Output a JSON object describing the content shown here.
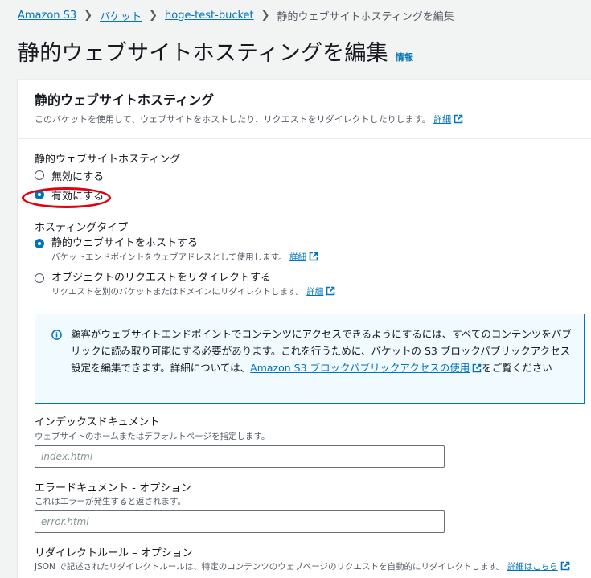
{
  "breadcrumb": {
    "items": [
      "Amazon S3",
      "バケット",
      "hoge-test-bucket"
    ],
    "current": "静的ウェブサイトホスティングを編集"
  },
  "page": {
    "title": "静的ウェブサイトホスティングを編集",
    "info_label": "情報"
  },
  "panel": {
    "title": "静的ウェブサイトホスティング",
    "description": "このバケットを使用して、ウェブサイトをホストしたり、リクエストをリダイレクトしたりします。",
    "description_link": "詳細"
  },
  "hosting": {
    "label": "静的ウェブサイトホスティング",
    "options": [
      "無効にする",
      "有効にする"
    ],
    "selected": "有効にする"
  },
  "hosting_type": {
    "label": "ホスティングタイプ",
    "options": [
      {
        "label": "静的ウェブサイトをホストする",
        "desc": "バケットエンドポイントをウェブアドレスとして使用します。",
        "link": "詳細"
      },
      {
        "label": "オブジェクトのリクエストをリダイレクトする",
        "desc": "リクエストを別のバケットまたはドメインにリダイレクトします。",
        "link": "詳細"
      }
    ],
    "selected": "静的ウェブサイトをホストする"
  },
  "alert": {
    "text_before": "顧客がウェブサイトエンドポイントでコンテンツにアクセスできるようにするには、すべてのコンテンツをパブリックに読み取り可能にする必要があります。これを行うために、バケットの S3 ブロックパブリックアクセス設定を編集できます。詳細については、",
    "link": "Amazon S3 ブロックパブリックアクセスの使用",
    "text_after": "をご覧ください"
  },
  "index_document": {
    "label": "インデックスドキュメント",
    "desc": "ウェブサイトのホームまたはデフォルトページを指定します。",
    "placeholder": "index.html",
    "value": ""
  },
  "error_document": {
    "label": "エラードキュメント - オプション",
    "desc": "これはエラーが発生すると返されます。",
    "placeholder": "error.html",
    "value": ""
  },
  "redirect_rules": {
    "label": "リダイレクトルール – オプション",
    "desc": "JSON で記述されたリダイレクトルールは、特定のコンテンツのウェブページのリクエストを自動的にリダイレクトします。",
    "link": "詳細はこちら"
  },
  "colors": {
    "link": "#0073bb",
    "highlight": "#e3000f",
    "alert_border": "#0073bb",
    "alert_bg": "#f1faff"
  }
}
